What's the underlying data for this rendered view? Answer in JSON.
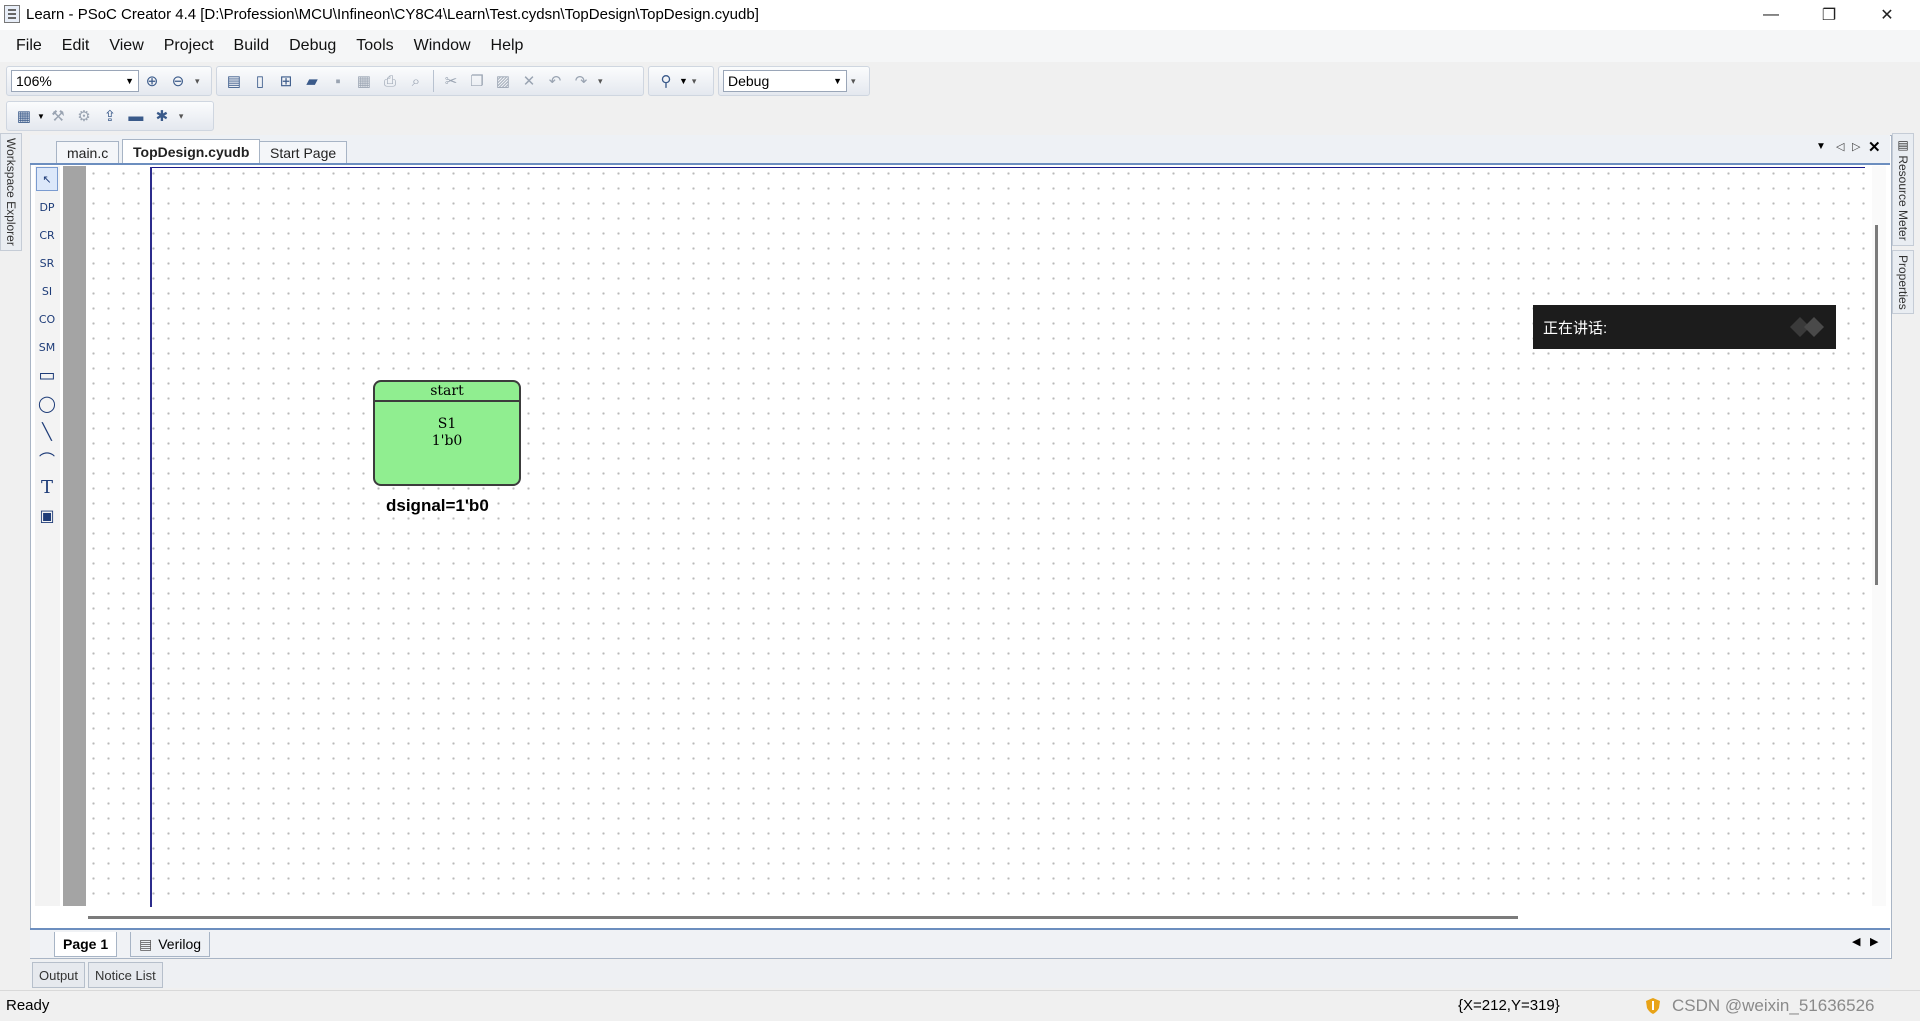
{
  "window": {
    "title": "Learn - PSoC Creator 4.4  [D:\\Profession\\MCU\\Infineon\\CY8C4\\Learn\\Test.cydsn\\TopDesign\\TopDesign.cyudb]",
    "minimize": "—",
    "restore": "❐",
    "close": "✕"
  },
  "menu": [
    {
      "label": "File"
    },
    {
      "label": "Edit"
    },
    {
      "label": "View"
    },
    {
      "label": "Project"
    },
    {
      "label": "Build"
    },
    {
      "label": "Debug"
    },
    {
      "label": "Tools"
    },
    {
      "label": "Window"
    },
    {
      "label": "Help"
    }
  ],
  "toolbar": {
    "zoom_value": "106%",
    "config_value": "Debug"
  },
  "side_tabs": {
    "left": "Workspace Explorer",
    "right_1": "Resource Meter",
    "right_2": "Properties"
  },
  "doc_tabs": [
    {
      "label": "main.c",
      "active": false
    },
    {
      "label": "TopDesign.cyudb",
      "active": true
    },
    {
      "label": "Start Page",
      "active": false
    }
  ],
  "palette": [
    {
      "icon": "pointer-icon",
      "glyph": "↖"
    },
    {
      "icon": "dp-icon",
      "glyph": "DP"
    },
    {
      "icon": "cr-icon",
      "glyph": "CR"
    },
    {
      "icon": "sr-icon",
      "glyph": "SR"
    },
    {
      "icon": "si-icon",
      "glyph": "SI"
    },
    {
      "icon": "co-icon",
      "glyph": "CO"
    },
    {
      "icon": "sm-icon",
      "glyph": "SM"
    },
    {
      "icon": "rectangle-icon",
      "glyph": "▭"
    },
    {
      "icon": "ellipse-icon",
      "glyph": "◯"
    },
    {
      "icon": "line-icon",
      "glyph": "╲"
    },
    {
      "icon": "arc-icon",
      "glyph": "⌒"
    },
    {
      "icon": "text-icon",
      "glyph": "T"
    },
    {
      "icon": "image-icon",
      "glyph": "▣"
    }
  ],
  "state": {
    "name": "start",
    "line1": "S1",
    "line2": "1'b0",
    "color": "#90ee90",
    "output": "dsignal=1'b0"
  },
  "overlay": {
    "speaking": "正在讲话:"
  },
  "page_tabs": [
    {
      "label": "Page 1",
      "active": true
    },
    {
      "label": "Verilog",
      "active": false
    }
  ],
  "bottom_tabs": [
    {
      "label": "Output"
    },
    {
      "label": "Notice List"
    }
  ],
  "status": {
    "text": "Ready",
    "coords": "{X=212,Y=319}",
    "watermark": "CSDN @weixin_51636526"
  }
}
